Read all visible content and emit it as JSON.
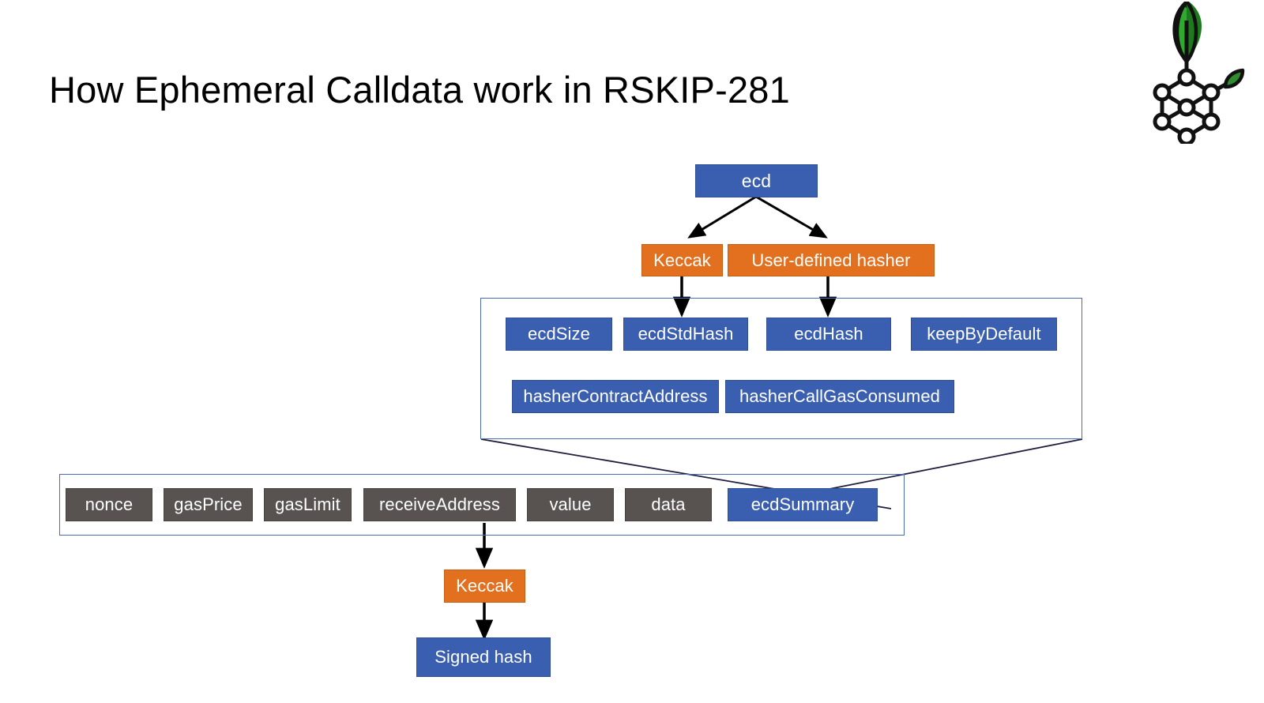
{
  "slide": {
    "title": "How Ephemeral Calldata work in RSKIP-281",
    "background_color": "#ffffff"
  },
  "logo": {
    "name": "rootstock-leaf-node-logo",
    "leaf_dark_color": "#1d7a1d",
    "leaf_light_color": "#2faa2f",
    "lattice_color": "#111111",
    "small_leaf_color": "#2e8b2e"
  },
  "palette": {
    "blue": "#3a5fb0",
    "blue_border": "#2f4f95",
    "orange": "#e3701e",
    "orange_border": "#c65f16",
    "gray": "#585350",
    "gray_border": "#474240",
    "frame_border": "#4a6bb5",
    "arrow": "#000000",
    "connector_line": "#1f1f3d",
    "text_on_fill": "#ffffff",
    "title_text": "#000000"
  },
  "diagram": {
    "root": {
      "label": "ecd",
      "color": "blue"
    },
    "hashers": [
      {
        "label": "Keccak",
        "color": "orange"
      },
      {
        "label": "User-defined hasher",
        "color": "orange"
      }
    ],
    "ecd_summary_fields_row1": [
      {
        "label": "ecdSize",
        "color": "blue"
      },
      {
        "label": "ecdStdHash",
        "color": "blue"
      },
      {
        "label": "ecdHash",
        "color": "blue"
      },
      {
        "label": "keepByDefault",
        "color": "blue"
      }
    ],
    "ecd_summary_fields_row2": [
      {
        "label": "hasherContractAddress",
        "color": "blue"
      },
      {
        "label": "hasherCallGasConsumed",
        "color": "blue"
      }
    ],
    "transaction_fields": [
      {
        "label": "nonce",
        "color": "gray"
      },
      {
        "label": "gasPrice",
        "color": "gray"
      },
      {
        "label": "gasLimit",
        "color": "gray"
      },
      {
        "label": "receiveAddress",
        "color": "gray"
      },
      {
        "label": "value",
        "color": "gray"
      },
      {
        "label": "data",
        "color": "gray"
      },
      {
        "label": "ecdSummary",
        "color": "blue"
      }
    ],
    "signing": {
      "hasher": {
        "label": "Keccak",
        "color": "orange"
      },
      "result": {
        "label": "Signed hash",
        "color": "blue"
      }
    }
  }
}
